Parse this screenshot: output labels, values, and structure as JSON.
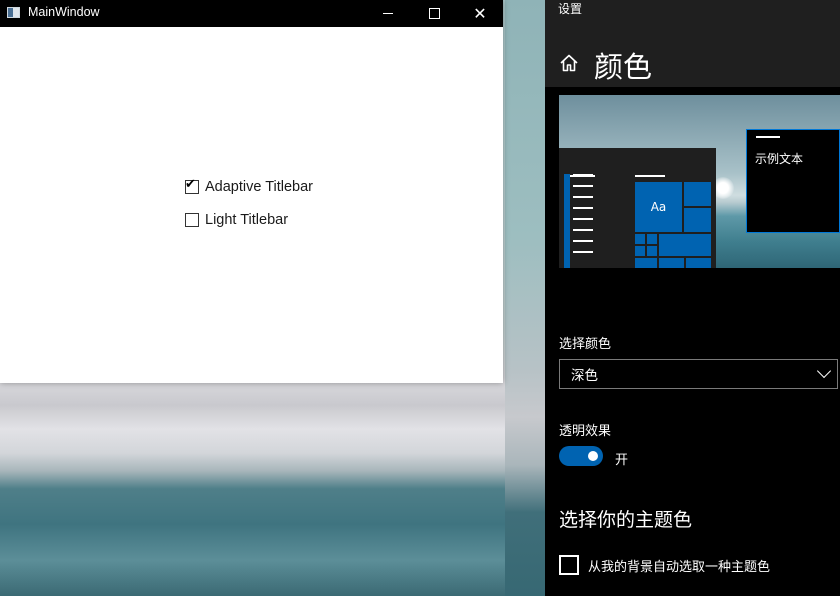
{
  "main_window": {
    "title": "MainWindow",
    "checkboxes": [
      {
        "label": "Adaptive Titlebar",
        "checked": true
      },
      {
        "label": "Light Titlebar",
        "checked": false
      }
    ]
  },
  "settings": {
    "window_title": "设置",
    "page_title": "颜色",
    "preview": {
      "tile_text": "Aa",
      "sample_text": "示例文本"
    },
    "choose_color_label": "选择颜色",
    "choose_color_value": "深色",
    "transparency_label": "透明效果",
    "transparency_state": "开",
    "transparency_on": true,
    "accent_heading": "选择你的主题色",
    "auto_accent_label": "从我的背景自动选取一种主题色",
    "auto_accent_checked": false,
    "accent_color": "#0063b1"
  }
}
